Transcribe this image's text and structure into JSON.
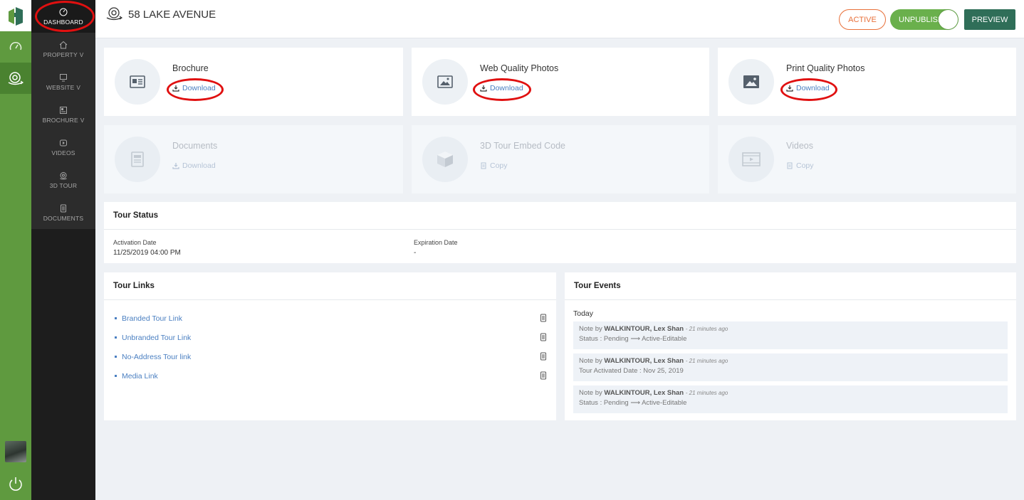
{
  "app": {
    "page_title": "58 LAKE AVENUE"
  },
  "header": {
    "active_label": "ACTIVE",
    "unpublish_label": "UNPUBLISH",
    "preview_label": "PREVIEW"
  },
  "sidebar": {
    "items": [
      {
        "label": "DASHBOARD",
        "icon": "gauge-icon"
      },
      {
        "label": "PROPERTY",
        "icon": "home-icon",
        "caret": "v"
      },
      {
        "label": "WEBSITE",
        "icon": "monitor-icon",
        "caret": "v"
      },
      {
        "label": "BROCHURE",
        "icon": "brochure-icon",
        "caret": "v"
      },
      {
        "label": "VIDEOS",
        "icon": "play-icon"
      },
      {
        "label": "3D TOUR",
        "icon": "camera-360-icon"
      },
      {
        "label": "DOCUMENTS",
        "icon": "document-icon"
      }
    ]
  },
  "cards": [
    {
      "title": "Brochure",
      "link": "Download",
      "icon": "brochure-icon"
    },
    {
      "title": "Web Quality Photos",
      "link": "Download",
      "icon": "image-icon"
    },
    {
      "title": "Print Quality Photos",
      "link": "Download",
      "icon": "image-icon"
    },
    {
      "title": "Documents",
      "link": "Download",
      "icon": "document-icon"
    },
    {
      "title": "3D Tour Embed Code",
      "link": "Copy",
      "icon": "cube-icon"
    },
    {
      "title": "Videos",
      "link": "Copy",
      "icon": "film-icon"
    }
  ],
  "tour_status": {
    "heading": "Tour Status",
    "activation_label": "Activation Date",
    "activation_value": "11/25/2019 04:00 PM",
    "expiration_label": "Expiration Date",
    "expiration_value": "-"
  },
  "tour_links": {
    "heading": "Tour Links",
    "items": [
      "Branded Tour Link",
      "Unbranded Tour Link",
      "No-Address Tour link",
      "Media Link"
    ]
  },
  "tour_events": {
    "heading": "Tour Events",
    "day": "Today",
    "items": [
      {
        "prefix": "Note by",
        "author": "WALKINTOUR, Lex Shan",
        "time": "- 21 minutes ago",
        "detail": "Status : Pending ⟶ Active-Editable"
      },
      {
        "prefix": "Note by",
        "author": "WALKINTOUR, Lex Shan",
        "time": "- 21 minutes ago",
        "detail": "Tour Activated Date : Nov 25, 2019"
      },
      {
        "prefix": "Note by",
        "author": "WALKINTOUR, Lex Shan",
        "time": "- 21 minutes ago",
        "detail": "Status : Pending ⟶ Active-Editable"
      }
    ]
  },
  "colors": {
    "rail_green": "#5f9a3f",
    "sidebar_dark": "#1d1d1d",
    "link_blue": "#4a7fc1",
    "active_orange": "#e8703a",
    "toggle_green": "#6ab04c",
    "preview_green": "#2f6e58",
    "highlight_red": "#e01010"
  }
}
